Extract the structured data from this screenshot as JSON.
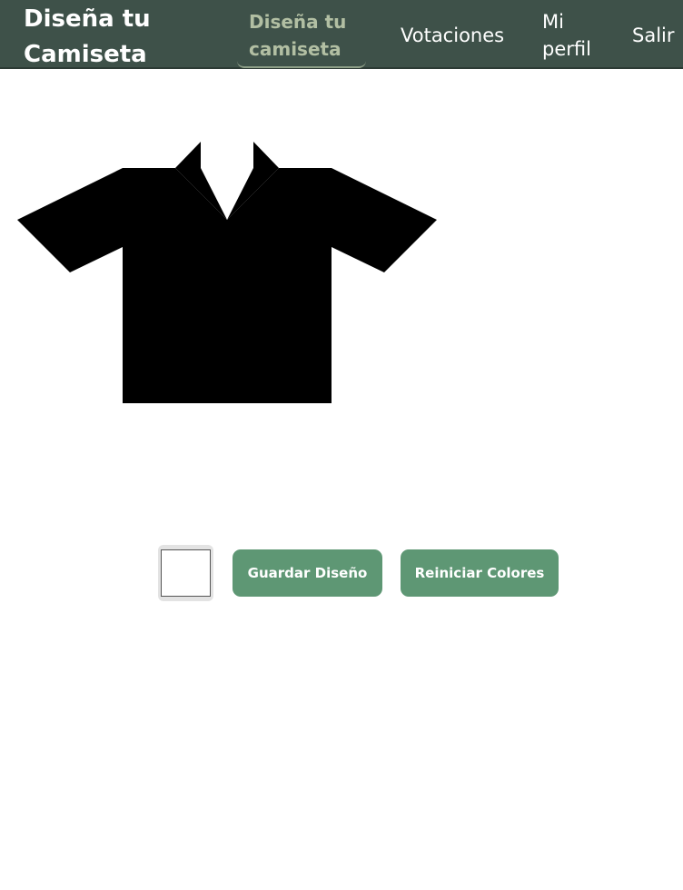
{
  "header": {
    "brand": "Diseña tu Camiseta",
    "nav": {
      "design": "Diseña tu camiseta",
      "votes": "Votaciones",
      "profile": "Mi perfil",
      "logout": "Salir"
    }
  },
  "designer": {
    "shirt_color": "#000000",
    "selected_color": "#ffffff",
    "save_label": "Guardar Diseño",
    "reset_label": "Reiniciar Colores"
  },
  "colors": {
    "header_bg": "#3e5149",
    "button_bg": "#5e9774",
    "active_nav": "#b2bfa3"
  },
  "icons": {
    "shirt": "polo-shirt-icon"
  }
}
